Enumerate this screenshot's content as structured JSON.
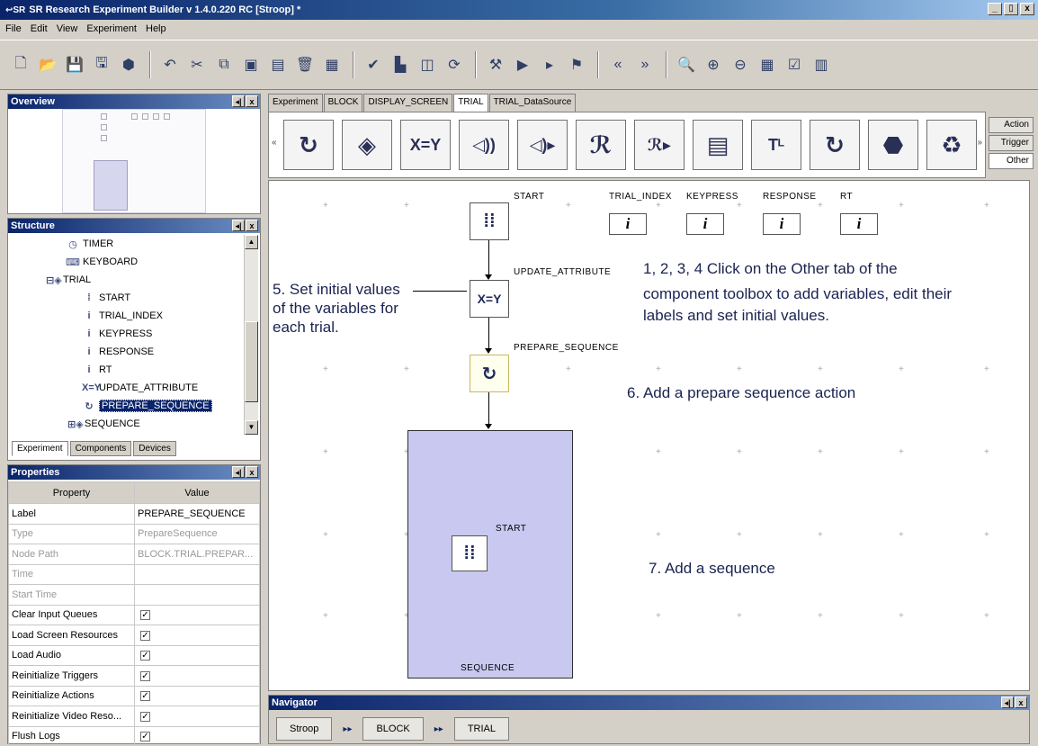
{
  "window": {
    "title": "SR Research Experiment Builder v 1.4.0.220 RC  [Stroop] *",
    "app_icon": "↩SR",
    "minimize": "_",
    "maximize": "▯",
    "close": "x"
  },
  "menu": [
    "File",
    "Edit",
    "View",
    "Experiment",
    "Help"
  ],
  "panels": {
    "overview": "Overview",
    "structure": "Structure",
    "properties": "Properties",
    "navigator": "Navigator",
    "dock_glyph": "◂|",
    "close_glyph": "x"
  },
  "structure_tree": [
    {
      "label": "TIMER",
      "icon": "◷",
      "indent": 60
    },
    {
      "label": "KEYBOARD",
      "icon": "⌨",
      "indent": 60
    },
    {
      "label": "TRIAL",
      "icon": "⊟◈",
      "indent": 38
    },
    {
      "label": "START",
      "icon": "⁞",
      "indent": 78
    },
    {
      "label": "TRIAL_INDEX",
      "icon": "i",
      "indent": 78
    },
    {
      "label": "KEYPRESS",
      "icon": "i",
      "indent": 78
    },
    {
      "label": "RESPONSE",
      "icon": "i",
      "indent": 78
    },
    {
      "label": "RT",
      "icon": "i",
      "indent": 78
    },
    {
      "label": "UPDATE_ATTRIBUTE",
      "icon": "X=Y",
      "indent": 78
    },
    {
      "label": "PREPARE_SEQUENCE",
      "icon": "↻",
      "indent": 78,
      "selected": true
    },
    {
      "label": "SEQUENCE",
      "icon": "⊞◈",
      "indent": 62
    }
  ],
  "structure_tabs": [
    "Experiment",
    "Components",
    "Devices"
  ],
  "properties": {
    "header": [
      "Property",
      "Value"
    ],
    "rows": [
      {
        "name": "Label",
        "value": "PREPARE_SEQUENCE",
        "dim": false
      },
      {
        "name": "Type",
        "value": "PrepareSequence",
        "dim": true
      },
      {
        "name": "Node Path",
        "value": "BLOCK.TRIAL.PREPAR...",
        "dim": true
      },
      {
        "name": "Time",
        "value": "",
        "dim": true
      },
      {
        "name": "Start Time",
        "value": "",
        "dim": true
      },
      {
        "name": "Clear Input Queues",
        "value": "✓",
        "check": true
      },
      {
        "name": "Load Screen Resources",
        "value": "✓",
        "check": true
      },
      {
        "name": "Load Audio",
        "value": "✓",
        "check": true
      },
      {
        "name": "Reinitialize Triggers",
        "value": "✓",
        "check": true
      },
      {
        "name": "Reinitialize Actions",
        "value": "✓",
        "check": true
      },
      {
        "name": "Reinitialize Video Reso...",
        "value": "✓",
        "check": true
      },
      {
        "name": "Flush Logs",
        "value": "✓",
        "check": true
      }
    ]
  },
  "doc_tabs": [
    "Experiment",
    "BLOCK",
    "DISPLAY_SCREEN",
    "TRIAL",
    "TRIAL_DataSource"
  ],
  "doc_tab_active": "TRIAL",
  "palette": {
    "left_arrow": "«",
    "right_arrow": "»",
    "buttons": [
      {
        "name": "sequence-loop-icon",
        "glyph": "↻"
      },
      {
        "name": "network-icon",
        "glyph": "◈"
      },
      {
        "name": "update-attribute-icon",
        "glyph": "X=Y"
      },
      {
        "name": "audio-icon",
        "glyph": "◁))"
      },
      {
        "name": "audio-play-icon",
        "glyph": "◁)▸"
      },
      {
        "name": "record-icon",
        "glyph": "ℛ"
      },
      {
        "name": "record-play-icon",
        "glyph": "ℛ▸"
      },
      {
        "name": "document-icon",
        "glyph": "▤"
      },
      {
        "name": "text-transform-icon",
        "glyph": "Tᴸ"
      },
      {
        "name": "prepare-sequence-icon",
        "glyph": "↻"
      },
      {
        "name": "stop-sign-icon",
        "glyph": "⬣"
      },
      {
        "name": "recycle-icon",
        "glyph": "♻"
      }
    ],
    "side_tabs": [
      "Action",
      "Trigger",
      "Other"
    ],
    "side_tab_active": "Other"
  },
  "canvas": {
    "node_labels": {
      "start": "START",
      "update_attribute": "UPDATE_ATTRIBUTE",
      "prepare_sequence": "PREPARE_SEQUENCE",
      "seq_start": "START",
      "sequence": "SEQUENCE"
    },
    "node_glyphs": {
      "traffic_light": "⁞⁞",
      "update": "X=Y",
      "prepare": "↻"
    },
    "variables": [
      {
        "label": "TRIAL_INDEX",
        "glyph": "i"
      },
      {
        "label": "KEYPRESS",
        "glyph": "i"
      },
      {
        "label": "RESPONSE",
        "glyph": "i"
      },
      {
        "label": "RT",
        "glyph": "i"
      }
    ],
    "notes": {
      "n1": "1, 2, 3, 4 Click on the Other tab of the",
      "n1b": "component toolbox to add variables, edit their",
      "n1c": "labels and set initial values.",
      "n5": "5. Set initial values",
      "n5b": "of the variables for",
      "n5c": "each trial.",
      "n6": "6. Add a prepare sequence action",
      "n7": "7. Add a sequence"
    }
  },
  "navigator": {
    "crumbs": [
      "Stroop",
      "BLOCK",
      "TRIAL"
    ],
    "sep": "▸▸"
  }
}
